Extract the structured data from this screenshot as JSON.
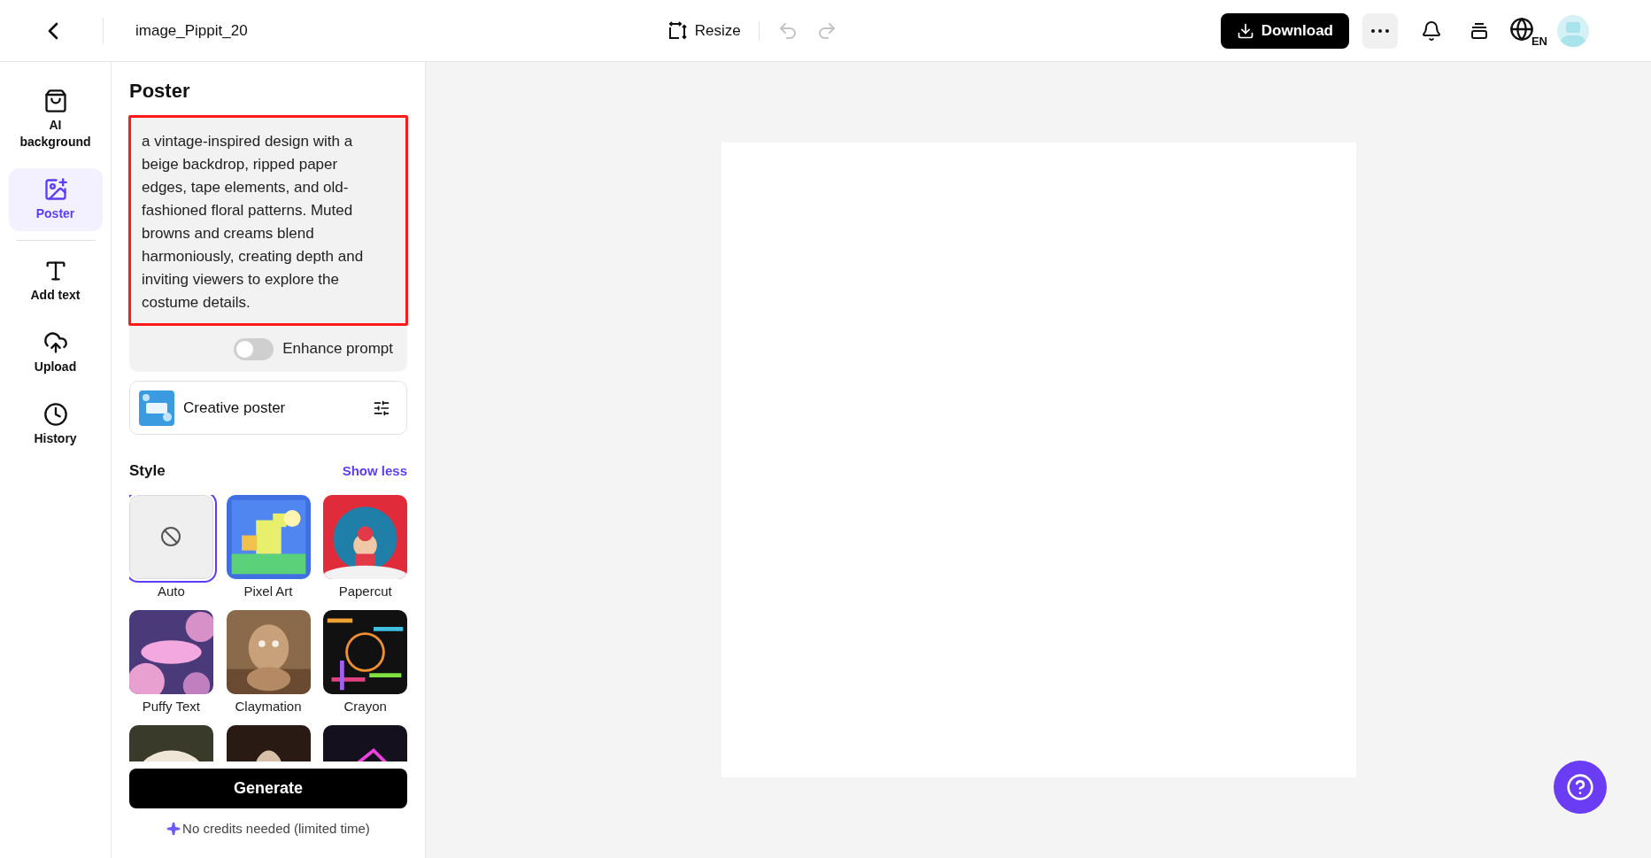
{
  "top_bar": {
    "title": "image_Pippit_20",
    "resize": "Resize",
    "undo_disabled": true,
    "redo_disabled": true,
    "download": "Download",
    "language": "EN"
  },
  "sidebar": {
    "items": [
      {
        "label": "AI background",
        "selected": false
      },
      {
        "label": "Poster",
        "selected": true
      },
      {
        "label": "Add text",
        "selected": false
      },
      {
        "label": "Upload",
        "selected": false
      },
      {
        "label": "History",
        "selected": false
      }
    ]
  },
  "panel": {
    "title": "Poster",
    "prompt": {
      "value": "a vintage-inspired design with a beige backdrop, ripped paper edges, tape elements, and old-fashioned floral patterns. Muted browns and creams blend harmoniously, creating depth and inviting viewers to explore the costume details.",
      "highlighted": true
    },
    "enhance_prompt": {
      "label": "Enhance prompt",
      "on": false
    },
    "template": {
      "label": "Creative poster"
    },
    "style": {
      "title": "Style",
      "toggle": "Show less",
      "items": [
        {
          "kind": "none",
          "label": "Auto",
          "selected": true
        },
        {
          "kind": "picture",
          "label": "Pixel Art",
          "selected": false
        },
        {
          "kind": "picture",
          "label": "Papercut",
          "selected": false
        },
        {
          "kind": "picture",
          "label": "Puffy Text",
          "selected": false
        },
        {
          "kind": "picture",
          "label": "Claymation",
          "selected": false
        },
        {
          "kind": "picture",
          "label": "Crayon",
          "selected": false
        },
        {
          "kind": "picture",
          "selected": false
        },
        {
          "kind": "picture",
          "selected": false
        },
        {
          "kind": "picture",
          "selected": false
        }
      ]
    },
    "generate": "Generate",
    "note": "No credits needed (limited time)"
  }
}
